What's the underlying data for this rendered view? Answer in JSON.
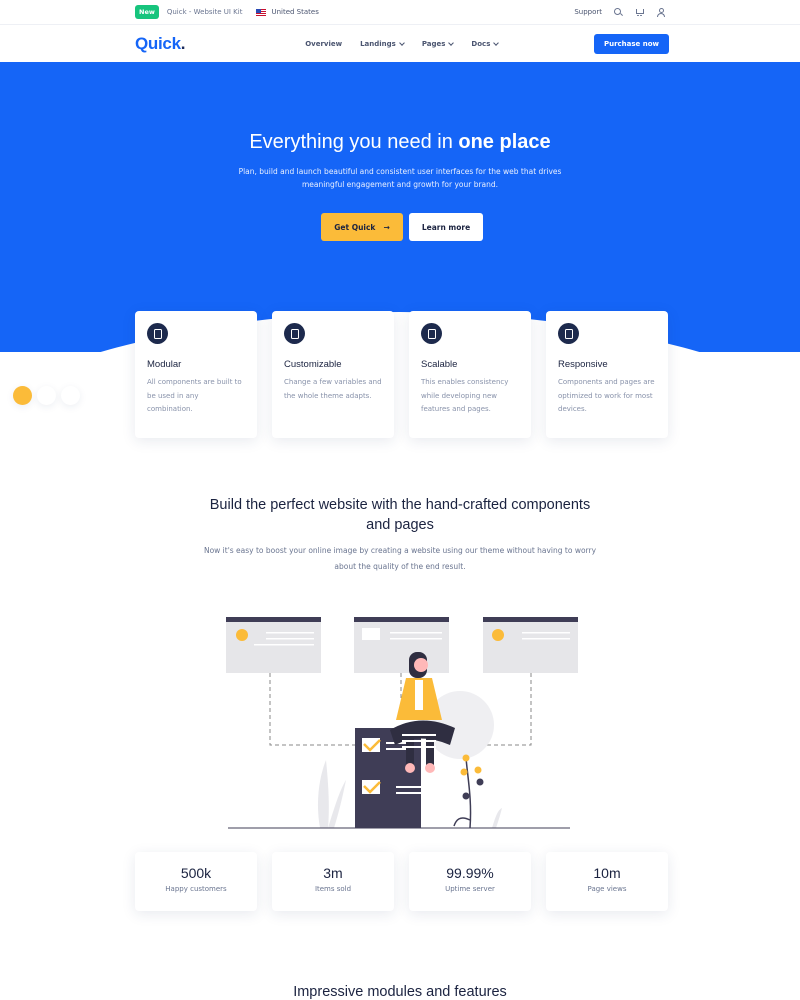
{
  "topbar": {
    "badge": "New",
    "kit": "Quick - Website UI Kit",
    "country": "United States",
    "support": "Support"
  },
  "navbar": {
    "logo_main": "Quick",
    "logo_dot": ".",
    "links": [
      "Overview",
      "Landings",
      "Pages",
      "Docs"
    ],
    "cta": "Purchase now"
  },
  "hero": {
    "title_regular": "Everything you need in",
    "title_bold": "one place",
    "subtitle": "Plan, build and launch beautiful and consistent user interfaces for the web that drives meaningful engagement and growth for your brand.",
    "primary_button": "Get Quick",
    "primary_arrow": "→",
    "secondary_button": "Learn more"
  },
  "features": [
    {
      "title": "Modular",
      "text": "All components are built to be used in any combination.",
      "icon": "drop-icon"
    },
    {
      "title": "Customizable",
      "text": "Change a few variables and the whole theme adapts.",
      "icon": "image-icon"
    },
    {
      "title": "Scalable",
      "text": "This enables consistency while developing new features and pages.",
      "icon": "external-link-icon"
    },
    {
      "title": "Responsive",
      "text": "Components and pages are optimized to work for most devices.",
      "icon": "mobile-icon"
    }
  ],
  "section2": {
    "title": "Build the perfect website with the hand-crafted components and pages",
    "subtitle": "Now it's easy to boost your online image by creating a website using our theme without having to worry about the quality of the end result."
  },
  "stats": [
    {
      "value": "500k",
      "label": "Happy customers"
    },
    {
      "value": "3m",
      "label": "Items sold"
    },
    {
      "value": "99.99%",
      "label": "Uptime server"
    },
    {
      "value": "10m",
      "label": "Page views"
    }
  ],
  "section3": {
    "title": "Impressive modules and features"
  },
  "colors": {
    "primary": "#1565f7",
    "accent": "#fbbb39",
    "dark": "#1b2340",
    "new_badge": "#17c47d"
  }
}
